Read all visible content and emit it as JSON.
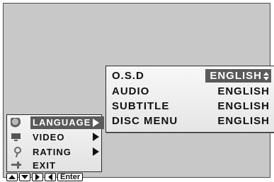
{
  "submenu": {
    "rows": [
      {
        "key": "O.S.D",
        "value": "ENGLISH",
        "selected": true
      },
      {
        "key": "AUDIO",
        "value": "ENGLISH",
        "selected": false
      },
      {
        "key": "SUBTITLE",
        "value": "ENGLISH",
        "selected": false
      },
      {
        "key": "DISC MENU",
        "value": "ENGLISH",
        "selected": false
      }
    ]
  },
  "mainmenu": {
    "items": [
      {
        "label": "LANGUAGE",
        "icon": "globe-icon",
        "active": true
      },
      {
        "label": "VIDEO",
        "icon": "monitor-icon",
        "active": false
      },
      {
        "label": "RATING",
        "icon": "key-icon",
        "active": false
      },
      {
        "label": "EXIT",
        "icon": "pointing-hand-icon",
        "active": false
      }
    ]
  },
  "buttons": {
    "up_icon": "up-arrow-icon",
    "down_icon": "down-arrow-icon",
    "right_icon": "right-arrow-icon",
    "left_icon": "left-arrow-icon",
    "enter_label": "Enter"
  },
  "colors": {
    "screen_bg": "#c8c8c8",
    "highlight": "#5a5a5a"
  }
}
